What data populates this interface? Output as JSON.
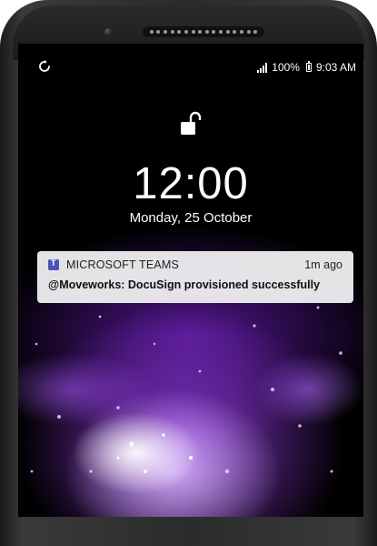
{
  "status_bar": {
    "battery": "100%",
    "time": "9:03 AM"
  },
  "lock_screen": {
    "clock": "12:00",
    "date": "Monday, 25 October"
  },
  "notification": {
    "app_name": "MICROSOFT TEAMS",
    "time": "1m ago",
    "message": "@Moveworks: DocuSign provisioned successfully",
    "app_color": "#4b53bc"
  },
  "icons": [
    "sync-icon",
    "signal-icon",
    "battery-icon",
    "unlock-icon",
    "teams-icon"
  ]
}
